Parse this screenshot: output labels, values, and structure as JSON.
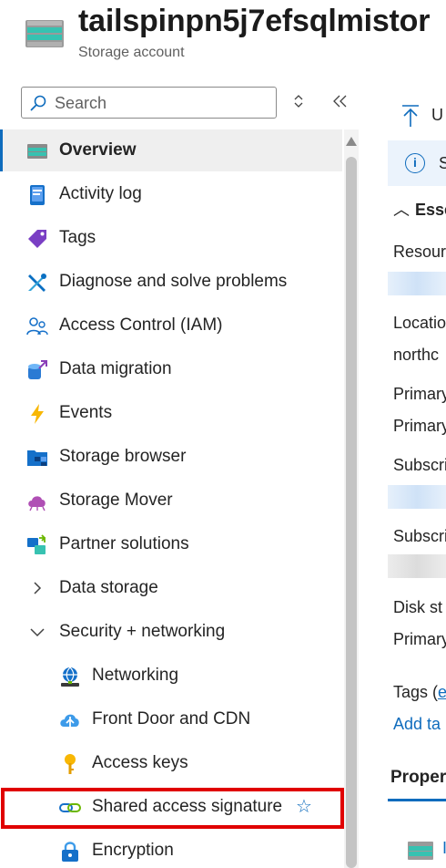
{
  "header": {
    "title": "tailspinpn5j7efsqlmistor",
    "subtitle": "Storage account",
    "icon": "storage-account-icon"
  },
  "search": {
    "placeholder": "Search",
    "value": ""
  },
  "controls": {
    "updown_icon": "chevron-up-down-icon",
    "collapse_icon": "double-chevron-left-icon"
  },
  "nav": {
    "items": [
      {
        "label": "Overview",
        "icon": "overview-icon",
        "active": true
      },
      {
        "label": "Activity log",
        "icon": "activity-log-icon"
      },
      {
        "label": "Tags",
        "icon": "tag-icon"
      },
      {
        "label": "Diagnose and solve problems",
        "icon": "wrench-icon"
      },
      {
        "label": "Access Control (IAM)",
        "icon": "people-icon"
      },
      {
        "label": "Data migration",
        "icon": "data-migration-icon"
      },
      {
        "label": "Events",
        "icon": "lightning-icon"
      },
      {
        "label": "Storage browser",
        "icon": "storage-browser-icon"
      },
      {
        "label": "Storage Mover",
        "icon": "cloud-icon"
      },
      {
        "label": "Partner solutions",
        "icon": "partner-icon"
      },
      {
        "label": "Data storage",
        "icon": "chevron-right-icon",
        "group": true,
        "expanded": false
      },
      {
        "label": "Security + networking",
        "icon": "chevron-down-icon",
        "group": true,
        "expanded": true
      },
      {
        "label": "Networking",
        "icon": "networking-icon"
      },
      {
        "label": "Front Door and CDN",
        "icon": "front-door-icon"
      },
      {
        "label": "Access keys",
        "icon": "key-icon"
      },
      {
        "label": "Shared access signature",
        "icon": "link-icon",
        "highlighted": true,
        "star_icon": "star-icon"
      },
      {
        "label": "Encryption",
        "icon": "lock-icon"
      }
    ]
  },
  "main": {
    "toolbar_text": "U",
    "toolbar_icon": "upload-icon",
    "info_text": "S",
    "essentials_label": "Esse",
    "fields": {
      "resource": "Resour",
      "location": "Locatio",
      "location_value": "northc",
      "primary1": "Primary",
      "primary2": "Primary",
      "subscription1": "Subscri",
      "subscription2": "Subscri",
      "disk": "Disk st",
      "primary3": "Primary",
      "tags": "Tags (",
      "tags_edit": "e",
      "add_tags": "Add ta"
    },
    "properties_tab": "Proper",
    "properties_item": "I"
  },
  "colors": {
    "accent": "#0f6cbd",
    "highlight": "#e00000",
    "active_bg": "#efefef"
  }
}
